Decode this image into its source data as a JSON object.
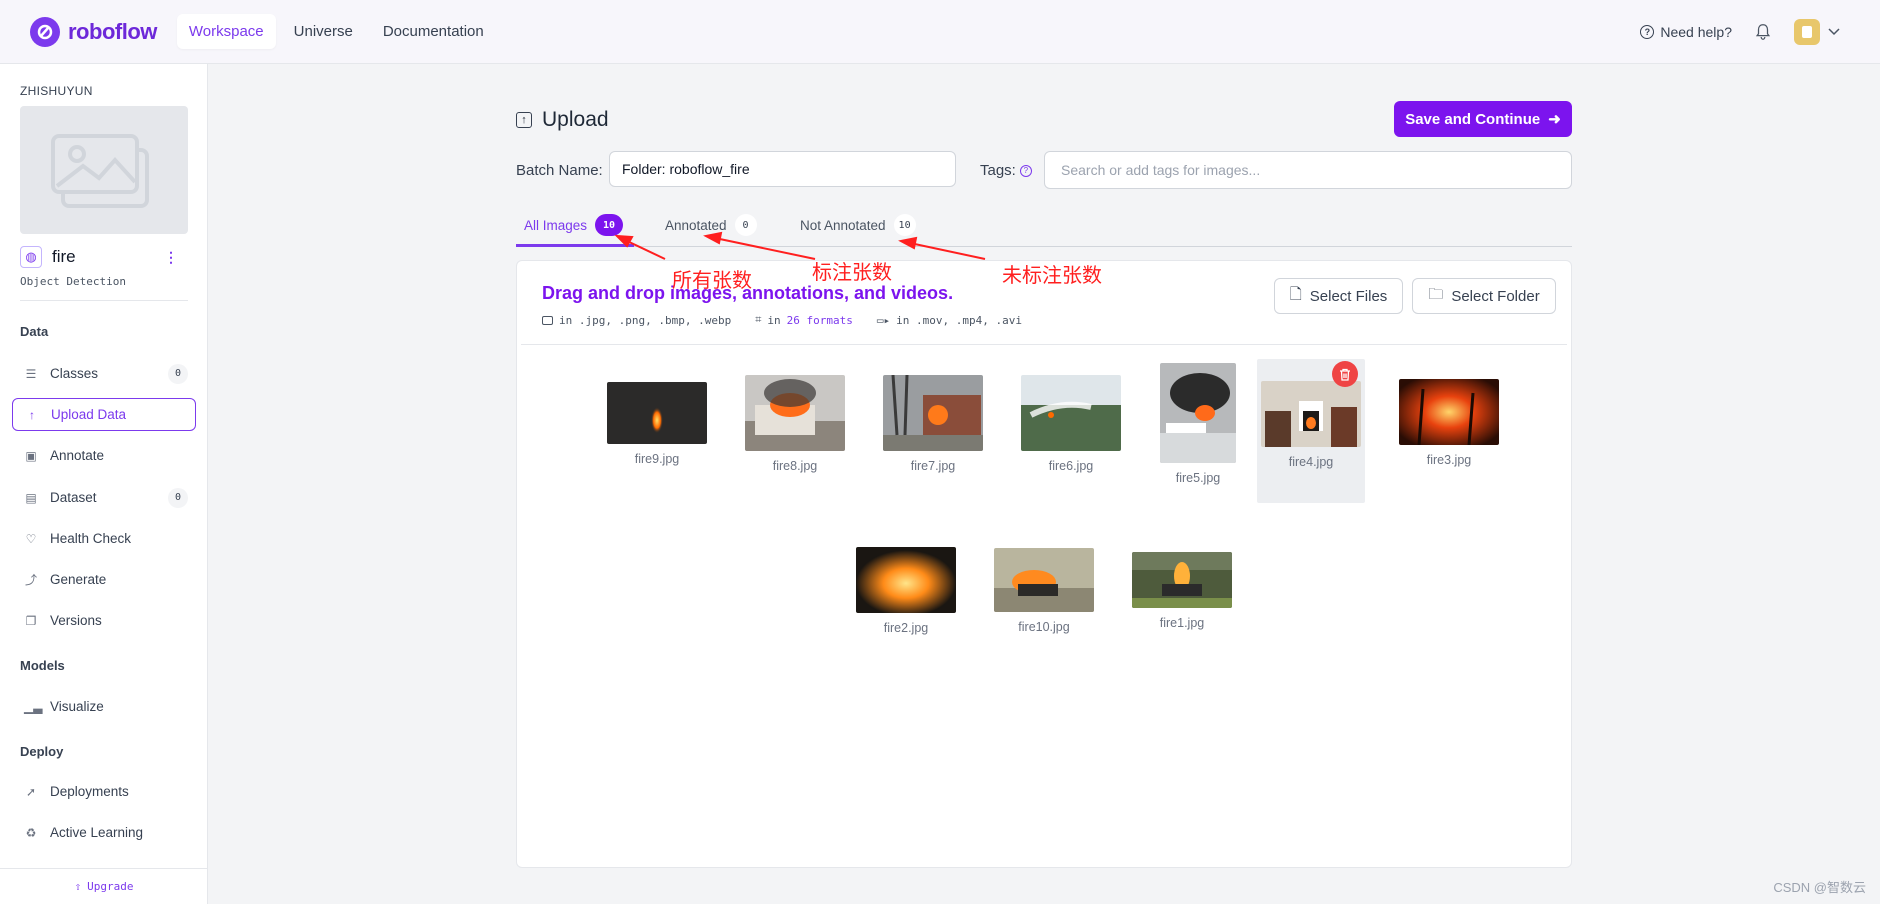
{
  "nav": {
    "brand": "roboflow",
    "links": [
      "Workspace",
      "Universe",
      "Documentation"
    ],
    "help": "Need help?"
  },
  "sidebar": {
    "workspace": "ZHISHUYUN",
    "project_name": "fire",
    "project_type": "Object Detection",
    "sections": {
      "data": "Data",
      "models": "Models",
      "deploy": "Deploy"
    },
    "items": [
      {
        "label": "Classes",
        "count": "0"
      },
      {
        "label": "Upload Data"
      },
      {
        "label": "Annotate"
      },
      {
        "label": "Dataset",
        "count": "0"
      },
      {
        "label": "Health Check"
      },
      {
        "label": "Generate"
      },
      {
        "label": "Versions"
      },
      {
        "label": "Visualize"
      },
      {
        "label": "Deployments"
      },
      {
        "label": "Active Learning"
      }
    ],
    "upgrade": "Upgrade"
  },
  "upload": {
    "title": "Upload",
    "save_button": "Save and Continue",
    "batch_label": "Batch Name:",
    "batch_value": "Folder: roboflow_fire",
    "tags_label": "Tags:",
    "tags_placeholder": "Search or add tags for images...",
    "tabs": [
      {
        "label": "All Images",
        "count": "10"
      },
      {
        "label": "Annotated",
        "count": "0"
      },
      {
        "label": "Not Annotated",
        "count": "10"
      }
    ],
    "drop_title": "Drag and drop images, annotations, and videos.",
    "formats": {
      "images": "in .jpg, .png, .bmp, .webp",
      "annotations_prefix": "in",
      "annotations_link": "26 formats",
      "videos": "in .mov, .mp4, .avi"
    },
    "select_files": "Select Files",
    "select_folder": "Select Folder",
    "files": [
      "fire9.jpg",
      "fire8.jpg",
      "fire7.jpg",
      "fire6.jpg",
      "fire5.jpg",
      "fire4.jpg",
      "fire3.jpg",
      "fire2.jpg",
      "fire10.jpg",
      "fire1.jpg"
    ]
  },
  "annotations": {
    "all": "所有张数",
    "annotated": "标注张数",
    "not_annotated": "未标注张数",
    "color": "#ff1f1f"
  },
  "watermark": "CSDN @智数云",
  "colors": {
    "accent": "#7c14ee",
    "delete": "#ef4444"
  }
}
